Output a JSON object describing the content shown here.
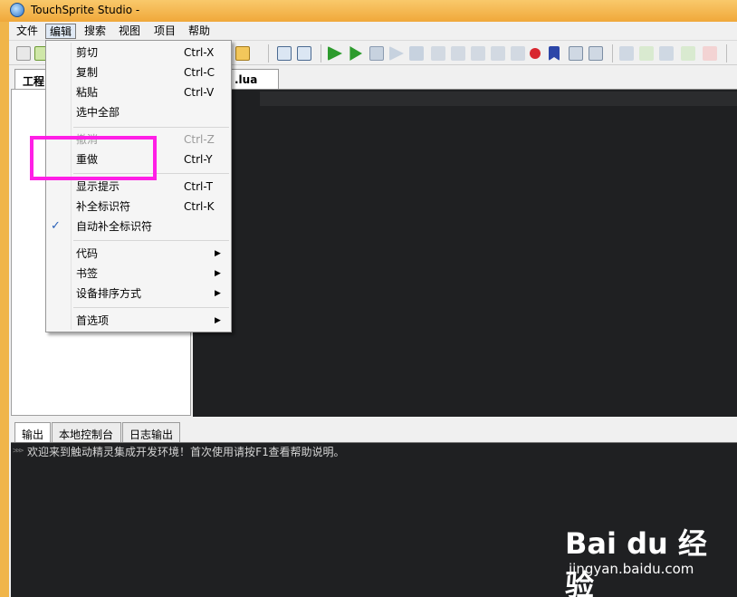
{
  "window": {
    "title": "TouchSprite Studio -"
  },
  "menubar": {
    "items": [
      "文件",
      "编辑",
      "搜索",
      "视图",
      "项目",
      "帮助"
    ]
  },
  "project_panel": {
    "tab": "工程"
  },
  "editor": {
    "tab": ".lua"
  },
  "edit_menu": {
    "items": [
      {
        "label": "剪切",
        "shortcut": "Ctrl-X"
      },
      {
        "label": "复制",
        "shortcut": "Ctrl-C"
      },
      {
        "label": "粘贴",
        "shortcut": "Ctrl-V"
      },
      {
        "label": "选中全部",
        "shortcut": ""
      },
      {
        "label": "撤消",
        "shortcut": "Ctrl-Z"
      },
      {
        "label": "重做",
        "shortcut": "Ctrl-Y"
      },
      {
        "label": "显示提示",
        "shortcut": "Ctrl-T"
      },
      {
        "label": "补全标识符",
        "shortcut": "Ctrl-K"
      },
      {
        "label": "自动补全标识符",
        "shortcut": "",
        "checked": true
      },
      {
        "label": "代码",
        "submenu": true
      },
      {
        "label": "书签",
        "submenu": true
      },
      {
        "label": "设备排序方式",
        "submenu": true
      },
      {
        "label": "首选项",
        "submenu": true
      }
    ]
  },
  "bottom_panel": {
    "tabs": [
      "输出",
      "本地控制台",
      "日志输出"
    ],
    "output_prompt": ">>>",
    "output_line": "欢迎来到触动精灵集成开发环境！首次使用请按F1查看帮助说明。"
  },
  "watermark": {
    "logo": "Bai du 经验",
    "url": "jingyan.baidu.com"
  },
  "colors": {
    "highlight": "#ff1fe6",
    "editor_bg": "#1f2022",
    "title_bar": "#f0b54a"
  }
}
